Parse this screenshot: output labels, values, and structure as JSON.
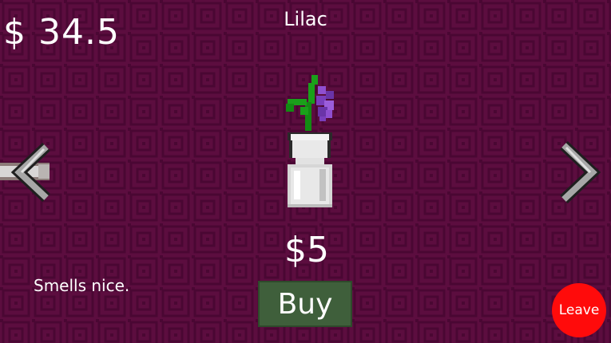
{
  "hud": {
    "money": "$ 34.5"
  },
  "item": {
    "name": "Lilac",
    "price": "$5",
    "description": "Smells nice.",
    "icon": "lilac-vase-icon"
  },
  "buttons": {
    "buy_label": "Buy",
    "leave_label": "Leave",
    "prev_icon": "chevron-left-icon",
    "next_icon": "chevron-right-icon"
  },
  "colors": {
    "background": "#5c0d3f",
    "pattern": "#4a0733",
    "buy_button": "#3f5f3b",
    "leave_button": "#ff0b0b",
    "lilac": "#8a4cc8",
    "stem": "#18a018"
  }
}
